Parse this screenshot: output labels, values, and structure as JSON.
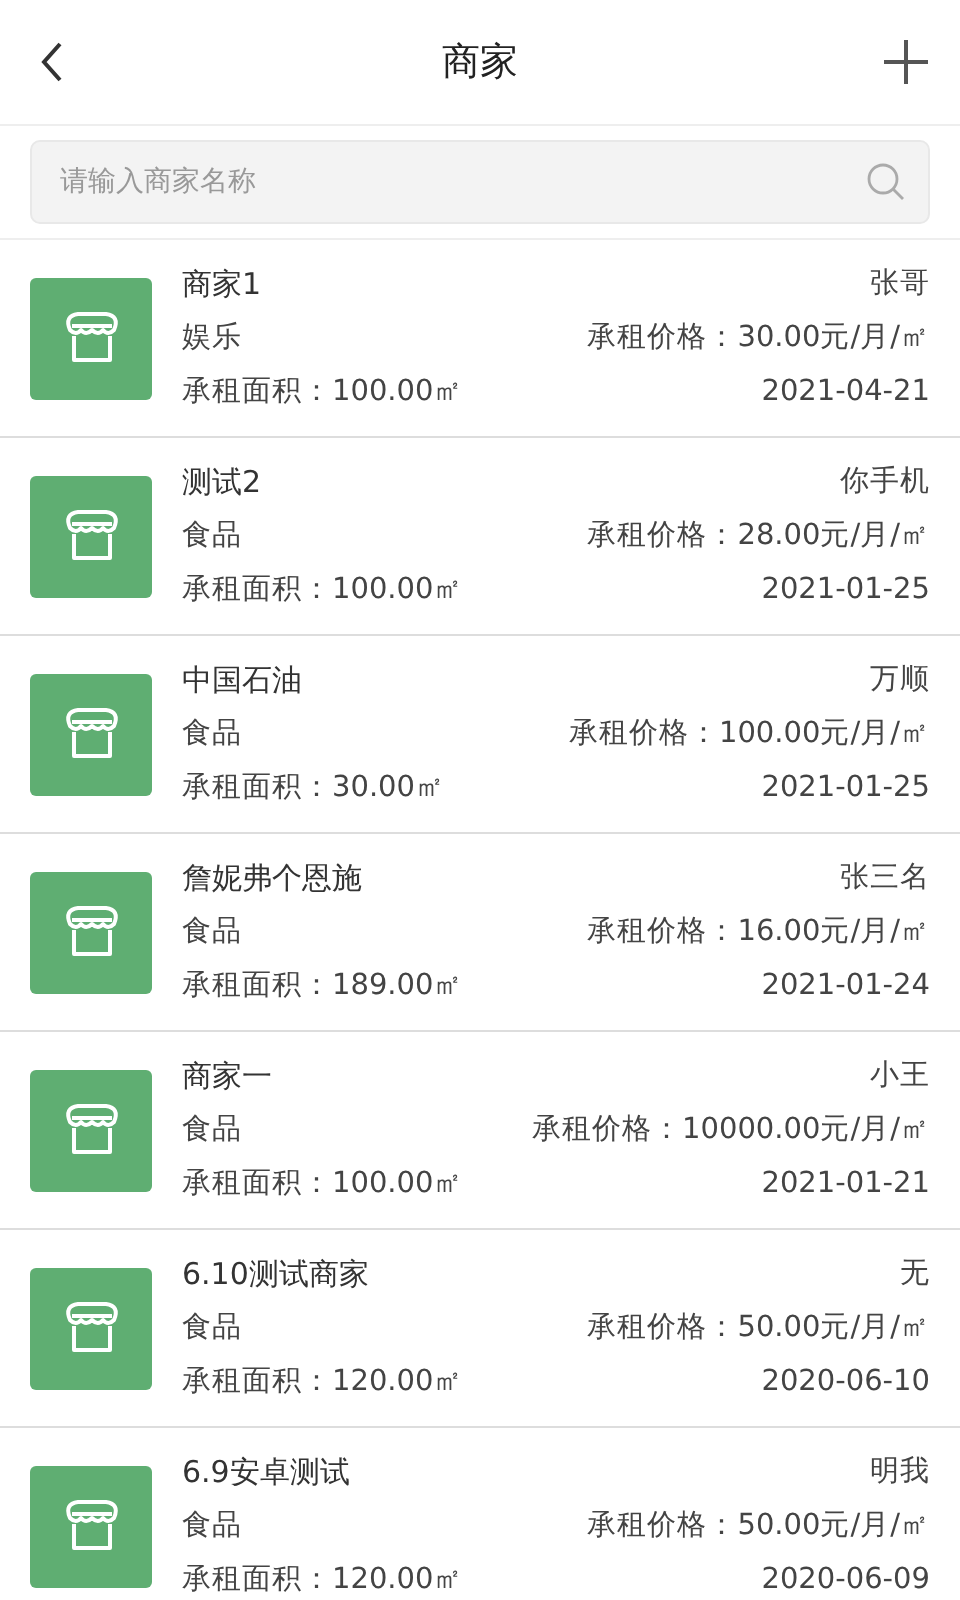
{
  "header": {
    "title": "商家"
  },
  "search": {
    "placeholder": "请输入商家名称"
  },
  "merchants": [
    {
      "name": "商家1",
      "contact": "张哥",
      "category": "娱乐",
      "price": "承租价格：30.00元/月/㎡",
      "area": "承租面积：100.00㎡",
      "date": "2021-04-21"
    },
    {
      "name": "测试2",
      "contact": "你手机",
      "category": "食品",
      "price": "承租价格：28.00元/月/㎡",
      "area": "承租面积：100.00㎡",
      "date": "2021-01-25"
    },
    {
      "name": "中国石油",
      "contact": "万顺",
      "category": "食品",
      "price": "承租价格：100.00元/月/㎡",
      "area": "承租面积：30.00㎡",
      "date": "2021-01-25"
    },
    {
      "name": "詹妮弗个恩施",
      "contact": "张三名",
      "category": "食品",
      "price": "承租价格：16.00元/月/㎡",
      "area": "承租面积：189.00㎡",
      "date": "2021-01-24"
    },
    {
      "name": "商家一",
      "contact": "小王",
      "category": "食品",
      "price": "承租价格：10000.00元/月/㎡",
      "area": "承租面积：100.00㎡",
      "date": "2021-01-21"
    },
    {
      "name": "6.10测试商家",
      "contact": "无",
      "category": "食品",
      "price": "承租价格：50.00元/月/㎡",
      "area": "承租面积：120.00㎡",
      "date": "2020-06-10"
    },
    {
      "name": "6.9安卓测试",
      "contact": "明我",
      "category": "食品",
      "price": "承租价格：50.00元/月/㎡",
      "area": "承租面积：120.00㎡",
      "date": "2020-06-09"
    }
  ]
}
